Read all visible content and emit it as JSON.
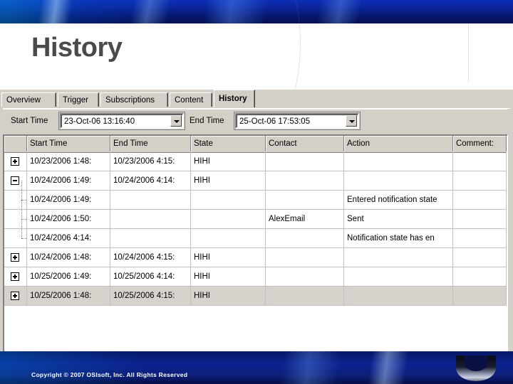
{
  "slide": {
    "title": "History",
    "copyright": "Copyright © 2007 OSIsoft, Inc. All Rights Reserved"
  },
  "app": {
    "tabs": [
      {
        "label": "Overview",
        "active": false
      },
      {
        "label": "Trigger",
        "active": false
      },
      {
        "label": "Subscriptions",
        "active": false
      },
      {
        "label": "Content",
        "active": false
      },
      {
        "label": "History",
        "active": true
      }
    ],
    "toolbar": {
      "start_time_label": "Start Time",
      "start_time_value": "23-Oct-06 13:16:40",
      "end_time_label": "End Time",
      "end_time_value": "25-Oct-06 17:53:05",
      "dropdown_icon": "chevron-down-icon"
    },
    "grid": {
      "columns": [
        "Start Time",
        "End Time",
        "State",
        "Contact",
        "Action",
        "Comment:"
      ],
      "rows": [
        {
          "toggle": "plus",
          "child": false,
          "selected": false,
          "cells": [
            "10/23/2006 1:48:",
            "10/23/2006 4:15:",
            "HIHI",
            "",
            "",
            ""
          ]
        },
        {
          "toggle": "minus",
          "child": false,
          "selected": false,
          "cells": [
            "10/24/2006 1:49:",
            "10/24/2006 4:14:",
            "HIHI",
            "",
            "",
            ""
          ]
        },
        {
          "toggle": "none",
          "child": true,
          "selected": false,
          "cells": [
            "10/24/2006 1:49:",
            "",
            "",
            "",
            "Entered notification state",
            ""
          ]
        },
        {
          "toggle": "none",
          "child": true,
          "selected": false,
          "cells": [
            "10/24/2006 1:50:",
            "",
            "",
            "AlexEmail",
            "Sent",
            ""
          ]
        },
        {
          "toggle": "none",
          "child": true,
          "selected": false,
          "cells": [
            "10/24/2006 4:14:",
            "",
            "",
            "",
            "Notification state has en",
            ""
          ]
        },
        {
          "toggle": "plus",
          "child": false,
          "selected": false,
          "cells": [
            "10/24/2006 1:48:",
            "10/24/2006 4:15:",
            "HIHI",
            "",
            "",
            ""
          ]
        },
        {
          "toggle": "plus",
          "child": false,
          "selected": false,
          "cells": [
            "10/25/2006 1:49:",
            "10/25/2006 4:14:",
            "HIHI",
            "",
            "",
            ""
          ]
        },
        {
          "toggle": "plus",
          "child": false,
          "selected": true,
          "cells": [
            "10/25/2006 1:48:",
            "10/25/2006 4:15:",
            "HIHI",
            "",
            "",
            ""
          ]
        }
      ]
    }
  },
  "colors": {
    "band_blue": "#0b2391",
    "chrome_gray": "#d4d0c8",
    "selection": "#d8d2cc",
    "title_gray": "#4a4a4a"
  }
}
